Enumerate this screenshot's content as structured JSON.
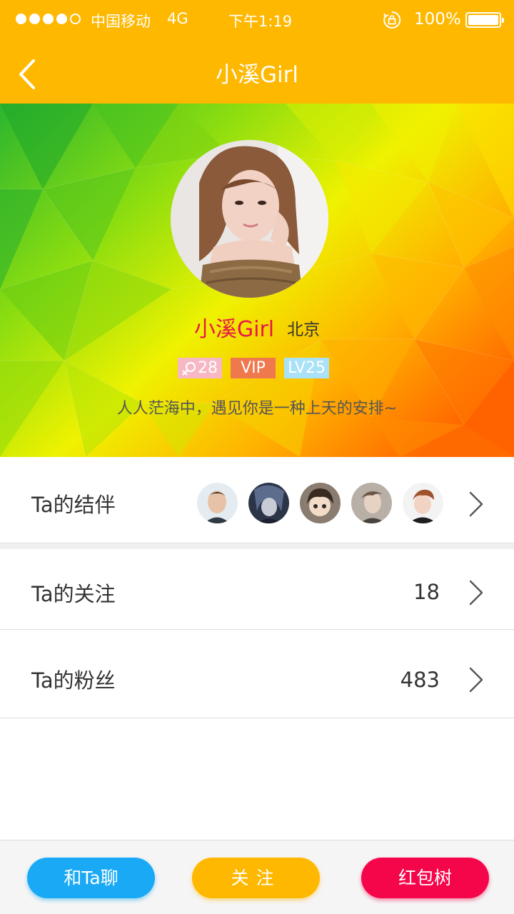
{
  "status_bar": {
    "carrier": "中国移动",
    "network": "4G",
    "time": "下午1:19",
    "battery": "100%",
    "signal_bars": 4,
    "signal_total": 5
  },
  "nav": {
    "title": "小溪Girl",
    "back_icon": "chevron-left-icon"
  },
  "profile": {
    "name": "小溪Girl",
    "city": "北京",
    "age": "28",
    "gender_icon": "female-icon",
    "vip": "VIP",
    "level": "LV25",
    "bio": "人人茫海中，遇见你是一种上天的安排~"
  },
  "rows": {
    "companions": {
      "label": "Ta的结伴",
      "count_shown": 5
    },
    "following": {
      "label": "Ta的关注",
      "value": "18"
    },
    "fans": {
      "label": "Ta的粉丝",
      "value": "483"
    }
  },
  "actions": {
    "chat": "和Ta聊",
    "follow": "关注",
    "red_packet_tree": "红包树"
  },
  "colors": {
    "brand": "#FFB800",
    "name": "#E8164B",
    "chat": "#1AAAF5",
    "follow": "#FFB800",
    "tree": "#F5064A",
    "vip": "#F0784D",
    "level": "#A9E1F7",
    "age": "#F7B7C3"
  }
}
